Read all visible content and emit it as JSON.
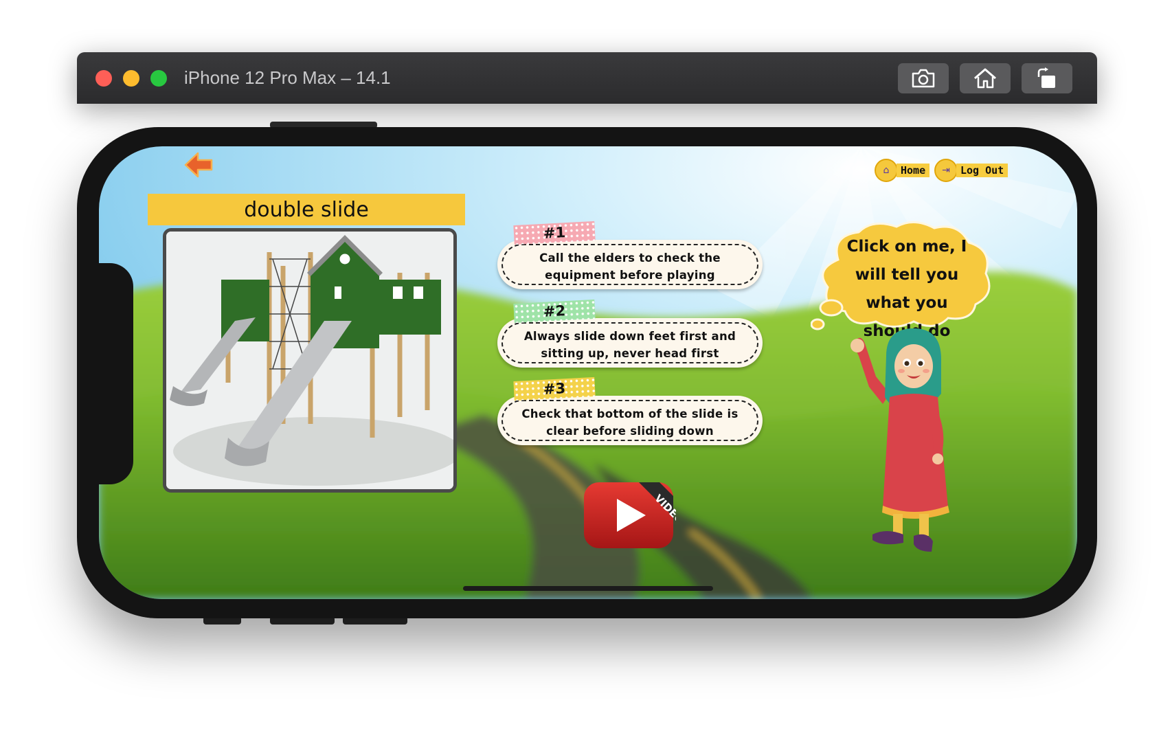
{
  "window": {
    "title": "iPhone 12 Pro Max – 14.1",
    "toolbar": [
      "screenshot-icon",
      "home-icon",
      "rotate-icon"
    ]
  },
  "app": {
    "nav": {
      "home_label": "Home",
      "logout_label": "Log Out"
    },
    "equipment_title": "double slide",
    "tips": [
      {
        "tag": "#1",
        "text": "Call the elders to check the equipment before playing",
        "tag_color": "#f6a9b2"
      },
      {
        "tag": "#2",
        "text": "Always slide down feet first and sitting up, never head first",
        "tag_color": "#9fe3a8"
      },
      {
        "tag": "#3",
        "text": "Check that bottom of the slide is clear before sliding down",
        "tag_color": "#f4d24a"
      }
    ],
    "video_badge": "VIDEO",
    "speech_bubble": "Click on me, I will tell you what you should do"
  },
  "colors": {
    "banner": "#f6c83d",
    "sky": "#9fd8f2",
    "grass": "#7ab92e",
    "video_red": "#d32626"
  }
}
